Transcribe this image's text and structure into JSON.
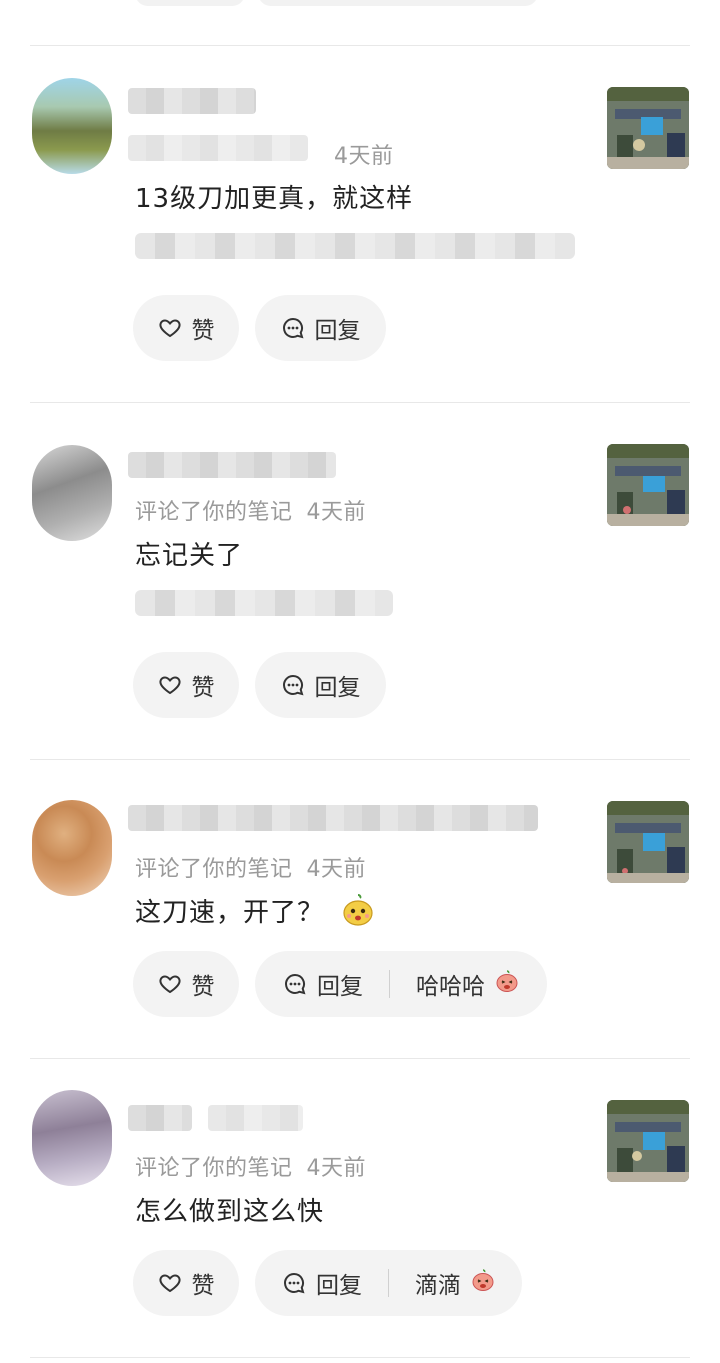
{
  "comments": [
    {
      "meta_text": "",
      "time": "4天前",
      "content": "13级刀加更真，就这样",
      "like_label": "赞",
      "reply_label": "回复",
      "quick_reply": "",
      "avatar_color": "#6f7c45"
    },
    {
      "meta_text": "评论了你的笔记",
      "time": "4天前",
      "content": "忘记关了",
      "like_label": "赞",
      "reply_label": "回复",
      "quick_reply": "",
      "avatar_color": "#9a9a9a"
    },
    {
      "meta_text": "评论了你的笔记",
      "time": "4天前",
      "content": "这刀速，开了？",
      "like_label": "赞",
      "reply_label": "回复",
      "quick_reply": "哈哈哈",
      "avatar_color": "#d9a070"
    },
    {
      "meta_text": "评论了你的笔记",
      "time": "4天前",
      "content": "怎么做到这么快",
      "like_label": "赞",
      "reply_label": "回复",
      "quick_reply": "滴滴",
      "avatar_color": "#a89ab0"
    }
  ],
  "icons": {
    "like": "heart-icon",
    "reply": "chat-bubble-icon",
    "emoji_content": "smiling-face-emoji",
    "emoji_quick": "laughing-face-emoji"
  },
  "colors": {
    "meta_gray": "#9a9a9a",
    "button_bg": "#f3f3f3",
    "divider": "#e8e8e8"
  }
}
